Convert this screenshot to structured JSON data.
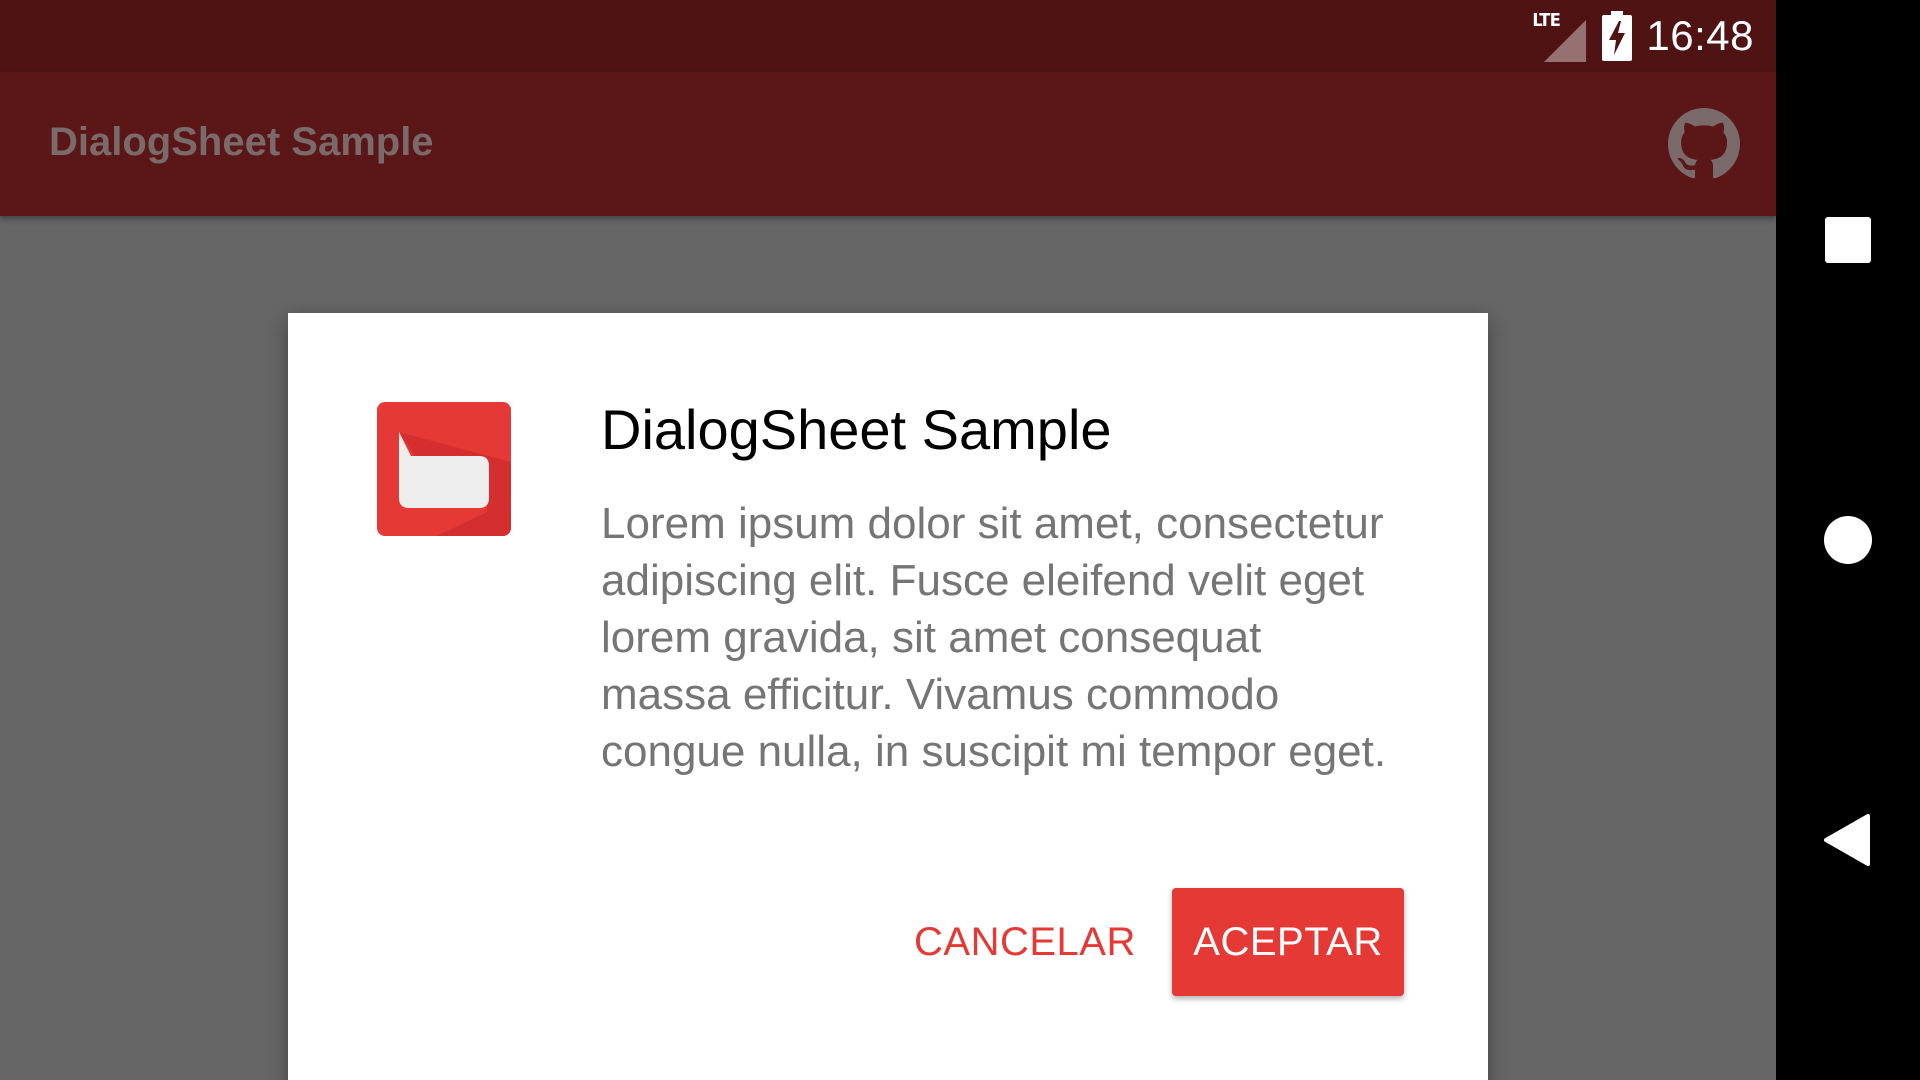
{
  "status_bar": {
    "time": "16:48",
    "network_label": "LTE",
    "icons": [
      "signal-icon",
      "battery-charging-icon"
    ]
  },
  "toolbar": {
    "title": "DialogSheet Sample",
    "action_icon": "github-icon"
  },
  "dialog": {
    "icon": "app-logo-icon",
    "title": "DialogSheet Sample",
    "message": "Lorem ipsum dolor sit amet, consectetur adipiscing elit. Fusce eleifend velit eget lorem gravida, sit amet consequat massa efficitur. Vivamus commodo congue nulla, in suscipit mi tempor eget.",
    "negative_button": "CANCELAR",
    "positive_button": "ACEPTAR"
  },
  "nav_bar": {
    "buttons": [
      "recents-icon",
      "home-icon",
      "back-icon"
    ]
  },
  "colors": {
    "status_bar": "#4f1314",
    "toolbar": "#5b1717",
    "accent": "#e53935",
    "scrim": "#666666",
    "dialog_bg": "#ffffff",
    "message_text": "#757575"
  }
}
